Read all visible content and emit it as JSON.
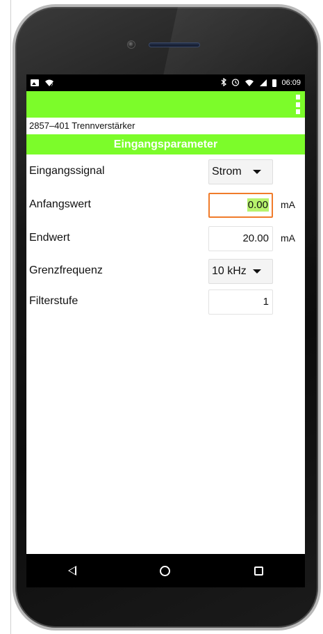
{
  "status_bar": {
    "time": "06:09",
    "left_icons": [
      "image-icon",
      "wifi-question-icon"
    ],
    "right_icons": [
      "bluetooth-icon",
      "alarm-icon",
      "wifi-icon",
      "signal-icon",
      "battery-icon"
    ]
  },
  "app_bar": {
    "menu_icon": "overflow-menu-icon",
    "accent_color": "#7cfc2a"
  },
  "device": {
    "title": "2857–401 Trennverstärker"
  },
  "section": {
    "title": "Eingangsparameter"
  },
  "fields": {
    "eingangssignal": {
      "label": "Eingangssignal",
      "value": "Strom"
    },
    "anfangswert": {
      "label": "Anfangswert",
      "value": "0.00",
      "unit": "mA"
    },
    "endwert": {
      "label": "Endwert",
      "value": "20.00",
      "unit": "mA"
    },
    "grenzfrequenz": {
      "label": "Grenzfrequenz",
      "value": "10 kHz"
    },
    "filterstufe": {
      "label": "Filterstufe",
      "value": "1"
    }
  },
  "nav_bar": {
    "icons": [
      "back-icon",
      "home-icon",
      "recent-apps-icon"
    ]
  }
}
